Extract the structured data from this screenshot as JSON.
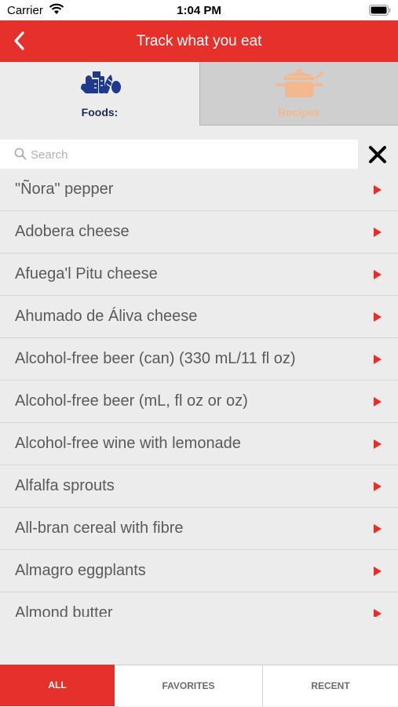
{
  "status_bar": {
    "carrier": "Carrier",
    "time": "1:04 PM"
  },
  "navbar": {
    "title": "Track what you eat"
  },
  "tabs": [
    {
      "label": "Foods:",
      "icon": "foods-icon"
    },
    {
      "label": "Recipes",
      "icon": "pot-icon"
    }
  ],
  "search": {
    "placeholder": "Search",
    "value": ""
  },
  "foods": [
    "\"Ñora\" pepper",
    "Adobera cheese",
    "Afuega'l Pitu cheese",
    "Ahumado de Áliva cheese",
    "Alcohol-free beer (can) (330 mL/11 fl oz)",
    "Alcohol-free beer (mL, fl oz or oz)",
    "Alcohol-free wine with lemonade",
    "Alfalfa sprouts",
    "All-bran cereal with fibre",
    "Almagro eggplants",
    "Almond butter"
  ],
  "bottom_tabs": {
    "all": "ALL",
    "favorites": "FAVORITES",
    "recent": "RECENT"
  },
  "colors": {
    "accent": "#e6302b",
    "foods_label": "#1a2c55",
    "recipes_label": "#f3b88d"
  }
}
